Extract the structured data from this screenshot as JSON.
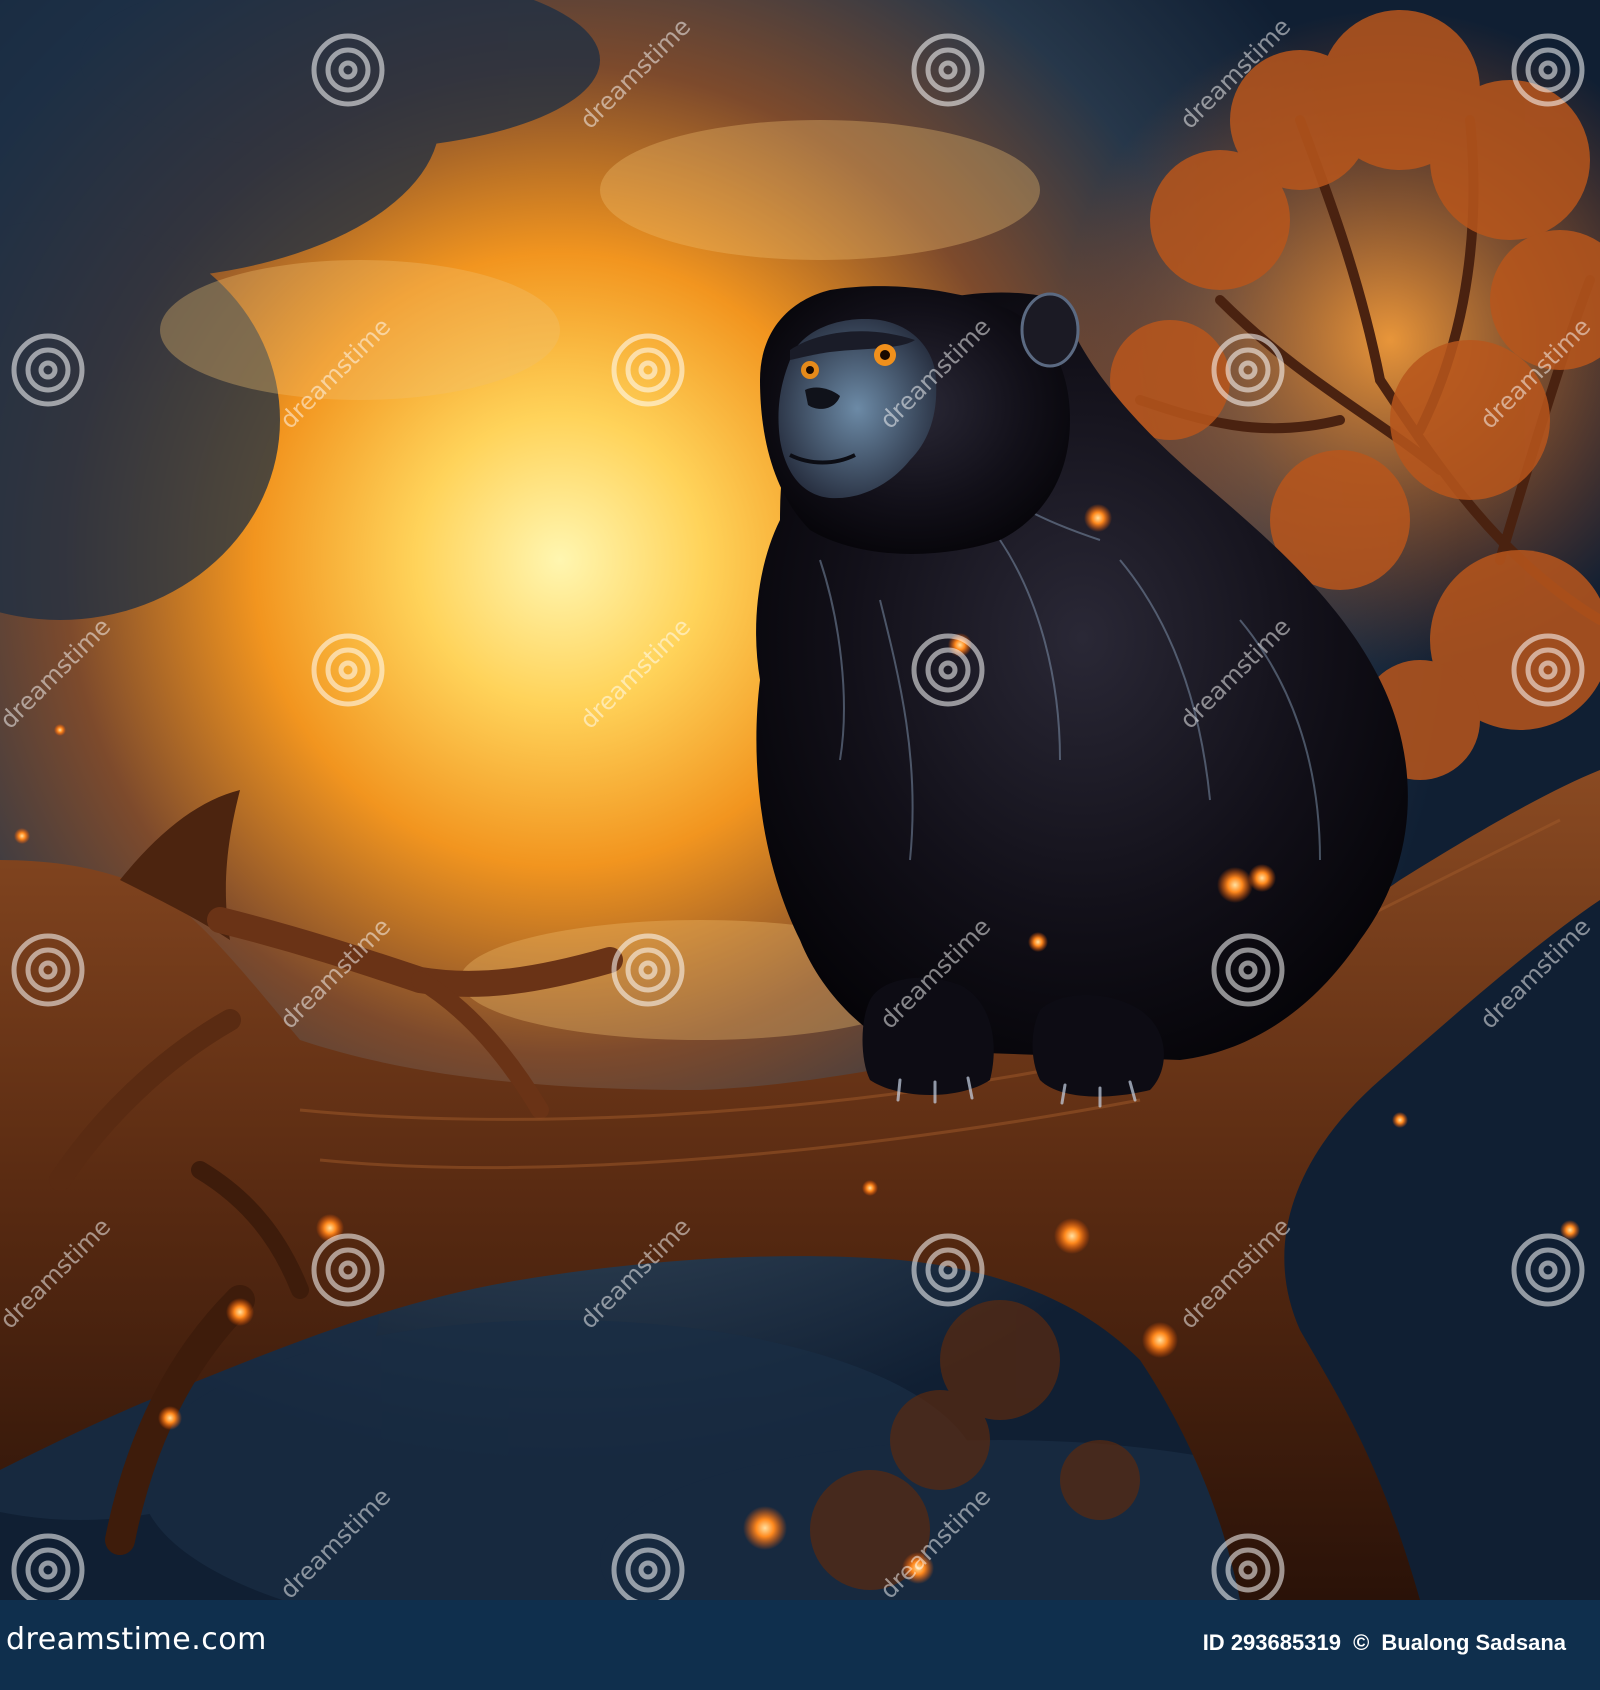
{
  "image": {
    "subject": "black-monkey",
    "palette": {
      "sky_dark": "#17324a",
      "glow_center": "#ffe58a",
      "glow_orange": "#f39a1e",
      "branch": "#5a2d14",
      "fur": "#0b0a12",
      "ember": "#ff7a1a"
    }
  },
  "watermark": {
    "text": "dreamstime"
  },
  "footer": {
    "site": "dreamstime.com",
    "id_label": "ID",
    "id_value": "293685319",
    "separator": "©",
    "author": "Bualong Sadsana",
    "background": "#0f2f4d"
  }
}
